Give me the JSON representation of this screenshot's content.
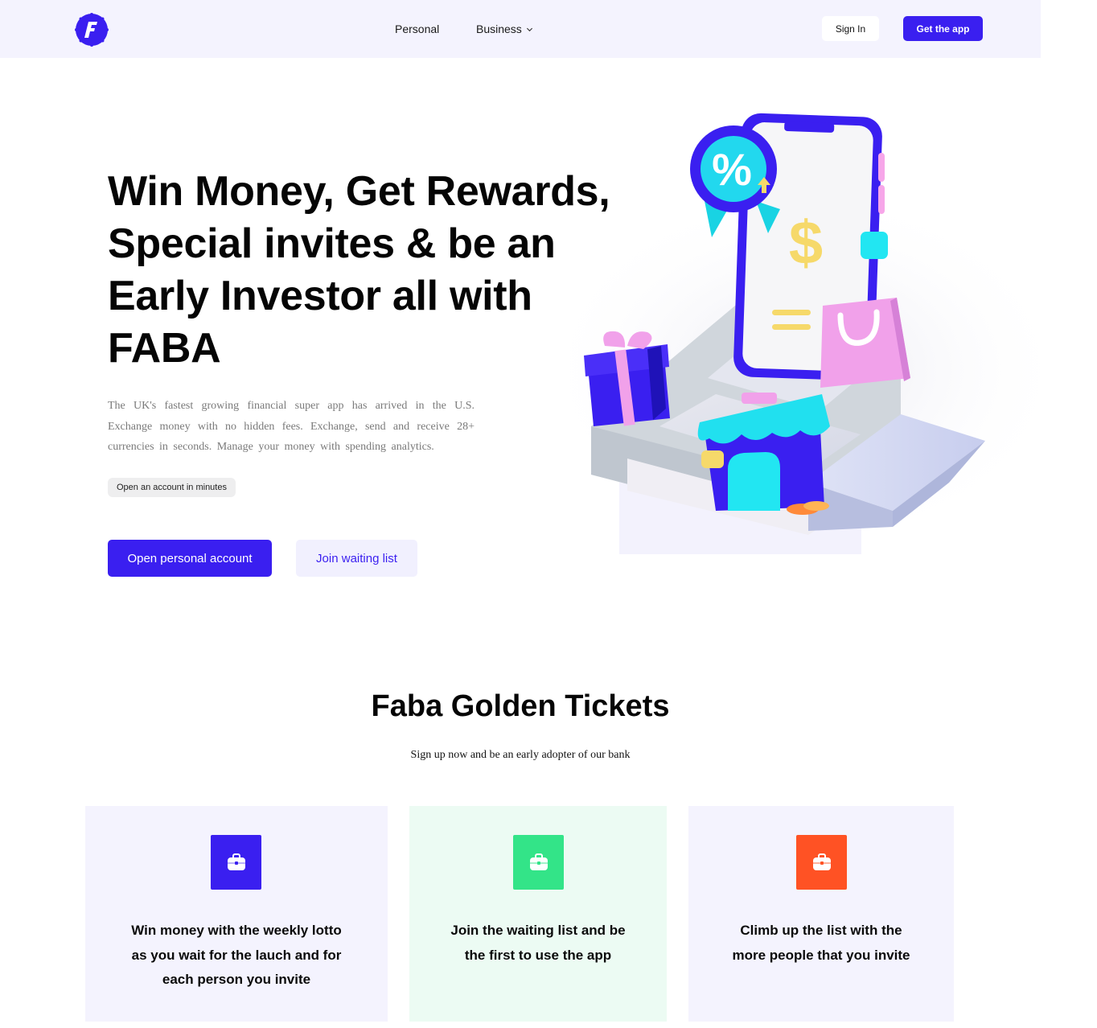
{
  "header": {
    "nav": {
      "personal": "Personal",
      "business": "Business"
    },
    "sign_in": "Sign In",
    "get_app": "Get the app"
  },
  "hero": {
    "title": "Win Money, Get Rewards, Special invites & be an Early Investor all with FABA",
    "description": "The UK's fastest growing financial super app has arrived in the U.S. Exchange money with no hidden fees. Exchange, send and receive 28+ currencies in seconds. Manage your money with spending analytics.",
    "pill": "Open an account in minutes",
    "primary_button": "Open personal account",
    "secondary_button": "Join waiting list"
  },
  "tickets": {
    "title": "Faba Golden Tickets",
    "subtitle": "Sign up now and be an early adopter of our bank",
    "cards": [
      {
        "icon": "briefcase-icon",
        "color": "#3a1ff0",
        "text": "Win money with the weekly lotto as you wait for the lauch and for each person you invite"
      },
      {
        "icon": "briefcase-icon",
        "color": "#33e488",
        "text": "Join the waiting list and be the first to use the app"
      },
      {
        "icon": "briefcase-icon",
        "color": "#ff5224",
        "text": "Climb up the list with the more people that you invite"
      }
    ]
  },
  "colors": {
    "brand": "#3a1ff0",
    "header_bg": "#f4f3fe",
    "green": "#33e488",
    "orange": "#ff5224"
  }
}
